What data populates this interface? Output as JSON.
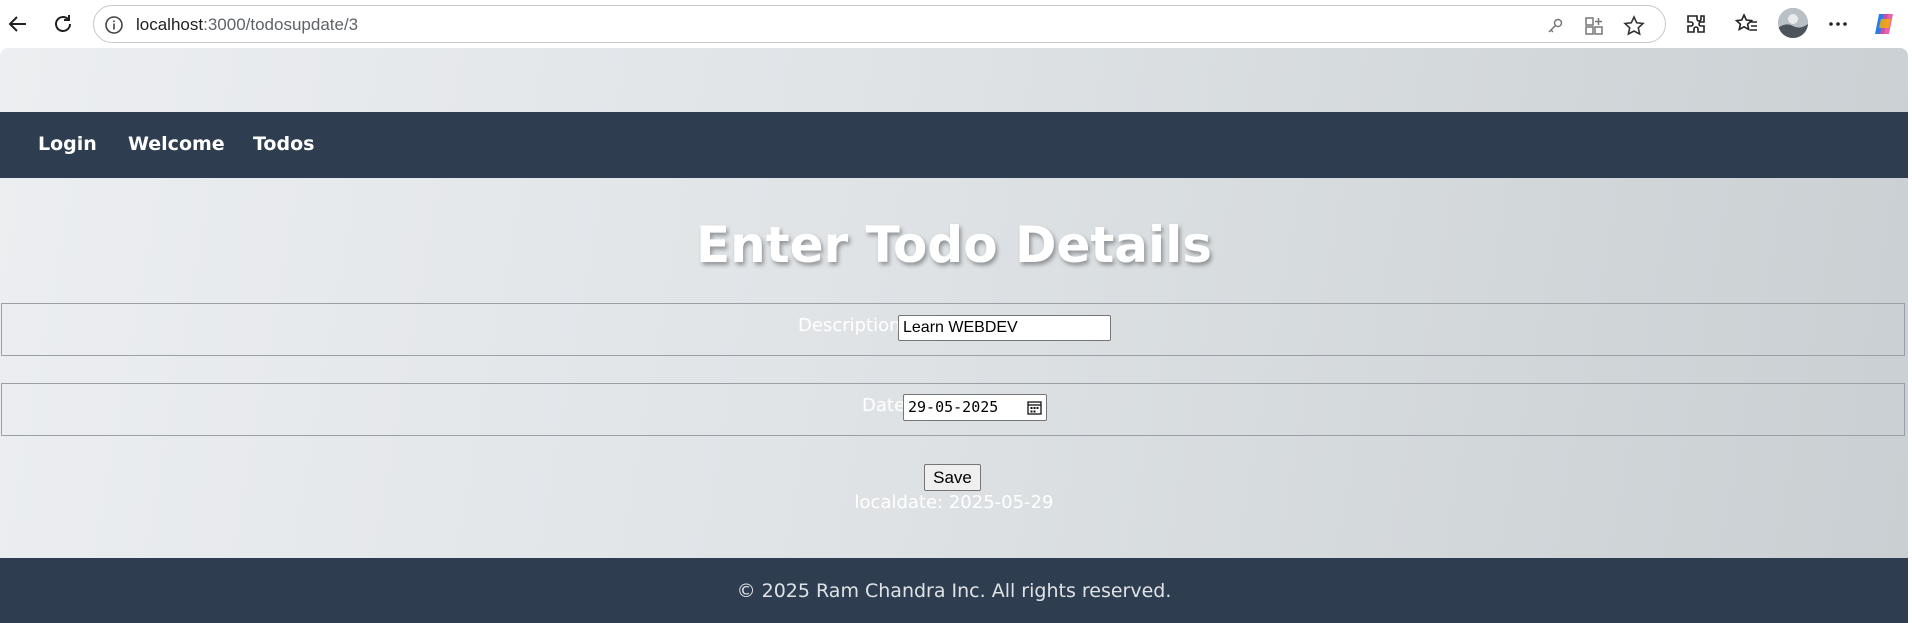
{
  "browser": {
    "url_host": "localhost",
    "url_path": ":3000/todosupdate/3"
  },
  "nav": {
    "items": [
      {
        "label": "Login"
      },
      {
        "label": "Welcome"
      },
      {
        "label": "Todos"
      }
    ]
  },
  "main": {
    "title": "Enter Todo Details",
    "description_label": "Description",
    "description_value": "Learn WEBDEV",
    "date_label": "Date",
    "date_value": "29-05-2025",
    "save_label": "Save",
    "localdate_text": "localdate: 2025-05-29"
  },
  "footer": {
    "text": "© 2025 Ram Chandra Inc. All rights reserved."
  },
  "colors": {
    "nav_bg": "#2e3e50",
    "footer_bg": "#2e3e50"
  },
  "icons": [
    "back-arrow-icon",
    "refresh-icon",
    "info-icon",
    "key-icon",
    "apps-icon",
    "star-icon",
    "extensions-icon",
    "favorites-icon",
    "avatar",
    "more-icon",
    "copilot-icon",
    "calendar-icon"
  ]
}
